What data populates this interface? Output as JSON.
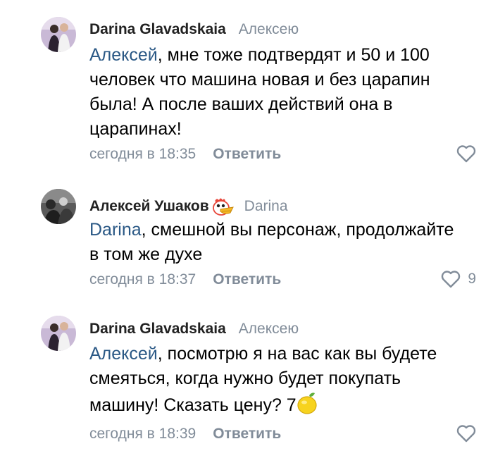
{
  "comments": [
    {
      "author": "Darina Glavadskaia",
      "reply_to": "Алексею",
      "mention": "Алексей",
      "text_lines": [
        ", мне тоже подтвердят и 50 и 100",
        "человек что машина новая и без царапин",
        "была! А после ваших действий она в",
        "царапинах!"
      ],
      "time": "сегодня в 18:35",
      "reply_label": "Ответить",
      "likes": ""
    },
    {
      "author": "Алексей Ушаков",
      "reply_to": "Darina",
      "mention": "Darina",
      "text_lines": [
        ", смешной вы персонаж, продолжайте",
        "в том же духе"
      ],
      "time": "сегодня в 18:37",
      "reply_label": "Ответить",
      "likes": "9"
    },
    {
      "author": "Darina Glavadskaia",
      "reply_to": "Алексею",
      "mention": "Алексей",
      "text_lines": [
        ", посмотрю я на вас как вы будете",
        "смеяться, когда нужно будет покупать",
        "машину! Сказать цену? 7"
      ],
      "time": "сегодня в 18:39",
      "reply_label": "Ответить",
      "likes": ""
    }
  ],
  "icons": {
    "like": "heart-outline-icon",
    "author_badge": "chicken-emoji-icon",
    "lemon": "lemon-emoji-icon"
  },
  "colors": {
    "link": "#2a5885",
    "meta": "#818c99",
    "name": "#222222"
  }
}
